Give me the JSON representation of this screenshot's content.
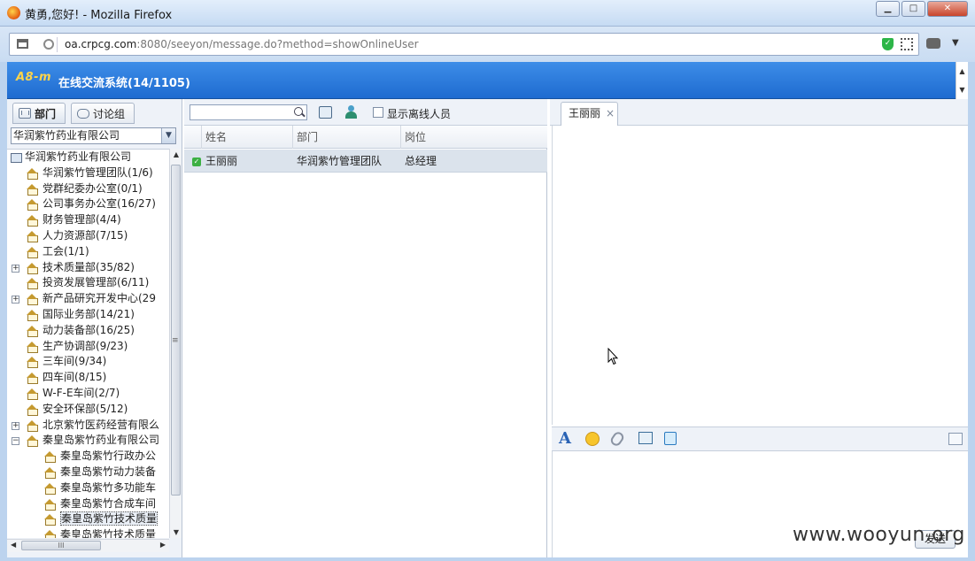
{
  "window": {
    "title": "黄勇,您好! - Mozilla Firefox",
    "btn_min": "▁",
    "btn_max": "□",
    "btn_close": "✕"
  },
  "browser": {
    "url_host": "oa.crpcg.com",
    "url_rest": ":8080/seeyon/message.do?method=showOnlineUser"
  },
  "app": {
    "logo": "A8-m",
    "title": "在线交流系统(14/1105)"
  },
  "left": {
    "tab_dept": "部门",
    "tab_group": "讨论组",
    "org_select": "华润紫竹药业有限公司",
    "tree_root": "华润紫竹药业有限公司",
    "tree_items": [
      {
        "label": "华润紫竹管理团队(1/6)",
        "expandable": false
      },
      {
        "label": "党群纪委办公室(0/1)",
        "expandable": false
      },
      {
        "label": "公司事务办公室(16/27)",
        "expandable": false
      },
      {
        "label": "财务管理部(4/4)",
        "expandable": false
      },
      {
        "label": "人力资源部(7/15)",
        "expandable": false
      },
      {
        "label": "工会(1/1)",
        "expandable": false
      },
      {
        "label": "技术质量部(35/82)",
        "expandable": true
      },
      {
        "label": "投资发展管理部(6/11)",
        "expandable": false
      },
      {
        "label": "新产品研究开发中心(29",
        "expandable": true
      },
      {
        "label": "国际业务部(14/21)",
        "expandable": false
      },
      {
        "label": "动力装备部(16/25)",
        "expandable": false
      },
      {
        "label": "生产协调部(9/23)",
        "expandable": false
      },
      {
        "label": "三车间(9/34)",
        "expandable": false
      },
      {
        "label": "四车间(8/15)",
        "expandable": false
      },
      {
        "label": "W-F-E车间(2/7)",
        "expandable": false
      },
      {
        "label": "安全环保部(5/12)",
        "expandable": false
      },
      {
        "label": "北京紫竹医药经营有限么",
        "expandable": true
      },
      {
        "label": "秦皇岛紫竹药业有限公司",
        "expandable": "open"
      }
    ],
    "tree_sub_items": [
      "秦皇岛紫竹行政办公",
      "秦皇岛紫竹动力装备",
      "秦皇岛紫竹多功能车",
      "秦皇岛紫竹合成车间",
      "秦皇岛紫竹技术质量",
      "秦皇岛紫竹技术质量"
    ]
  },
  "middle": {
    "search_placeholder": "",
    "show_offline_label": "显示离线人员",
    "columns": [
      "姓名",
      "部门",
      "岗位"
    ],
    "rows": [
      {
        "name": "王丽丽",
        "dept": "华润紫竹管理团队",
        "position": "总经理"
      }
    ]
  },
  "right": {
    "chat_tab": "王丽丽",
    "chat_tab_close": "×",
    "send_label": "发送"
  },
  "watermark": "www.wooyun.org"
}
